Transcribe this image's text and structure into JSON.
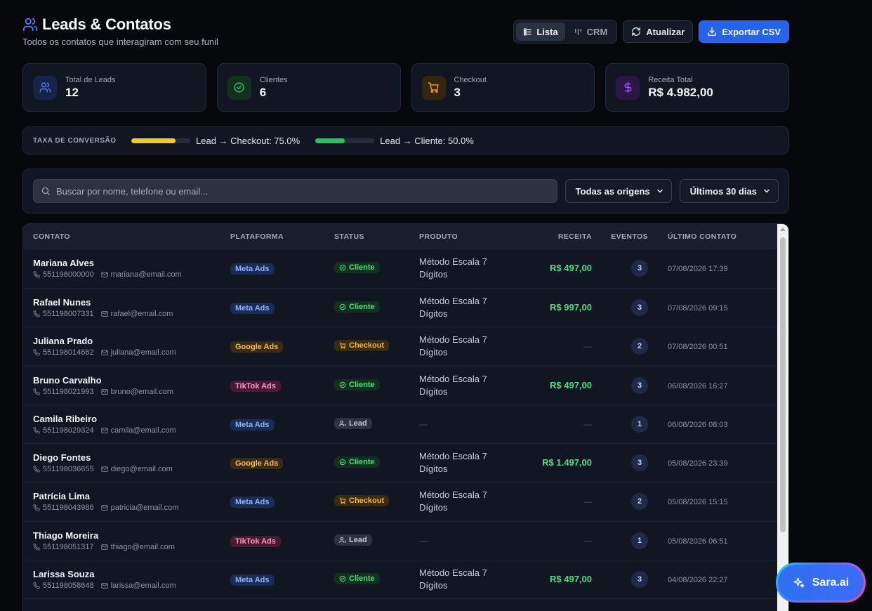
{
  "header": {
    "title": "Leads & Contatos",
    "subtitle": "Todos os contatos que interagiram com seu funil",
    "view_list": "Lista",
    "view_crm": "CRM",
    "refresh": "Atualizar",
    "export": "Exportar CSV"
  },
  "stats": [
    {
      "label": "Total de Leads",
      "value": "12",
      "icon": "users-icon",
      "color": "#4d7dff"
    },
    {
      "label": "Clientes",
      "value": "6",
      "icon": "check-circle-icon",
      "color": "#22c55e"
    },
    {
      "label": "Checkout",
      "value": "3",
      "icon": "cart-icon",
      "color": "#f59e0b"
    },
    {
      "label": "Receita Total",
      "value": "R$ 4.982,00",
      "icon": "dollar-icon",
      "color": "#a855f7"
    }
  ],
  "conversion": {
    "label": "TAXA DE CONVERSÃO",
    "items": [
      {
        "text": "Lead → Checkout: 75.0%",
        "percent": 75,
        "color": "#facc15"
      },
      {
        "text": "Lead → Cliente: 50.0%",
        "percent": 50,
        "color": "#22c55e"
      }
    ]
  },
  "filters": {
    "search_placeholder": "Buscar por nome, telefone ou email...",
    "origin": "Todas as origens",
    "period": "Últimos 30 dias"
  },
  "table": {
    "columns": {
      "contact": "CONTATO",
      "platform": "PLATAFORMA",
      "status": "STATUS",
      "product": "PRODUTO",
      "revenue": "RECEITA",
      "events": "EVENTOS",
      "last": "ÚLTIMO CONTATO"
    },
    "rows": [
      {
        "name": "Mariana Alves",
        "phone": "551198000000",
        "email": "mariana@email.com",
        "platform": "Meta Ads",
        "status": "Cliente",
        "product": "Método Escala 7 Dígitos",
        "revenue": "R$ 497,00",
        "events": "3",
        "last": "07/08/2026 17:39"
      },
      {
        "name": "Rafael Nunes",
        "phone": "551198007331",
        "email": "rafael@email.com",
        "platform": "Meta Ads",
        "status": "Cliente",
        "product": "Método Escala 7 Dígitos",
        "revenue": "R$ 997,00",
        "events": "3",
        "last": "07/08/2026 09:15"
      },
      {
        "name": "Juliana Prado",
        "phone": "551198014662",
        "email": "juliana@email.com",
        "platform": "Google Ads",
        "status": "Checkout",
        "product": "Método Escala 7 Dígitos",
        "revenue": "—",
        "events": "2",
        "last": "07/08/2026 00:51"
      },
      {
        "name": "Bruno Carvalho",
        "phone": "551198021993",
        "email": "bruno@email.com",
        "platform": "TikTok Ads",
        "status": "Cliente",
        "product": "Método Escala 7 Dígitos",
        "revenue": "R$ 497,00",
        "events": "3",
        "last": "06/08/2026 16:27"
      },
      {
        "name": "Camila Ribeiro",
        "phone": "551198029324",
        "email": "camila@email.com",
        "platform": "Meta Ads",
        "status": "Lead",
        "product": "—",
        "revenue": "—",
        "events": "1",
        "last": "06/08/2026 08:03"
      },
      {
        "name": "Diego Fontes",
        "phone": "551198036655",
        "email": "diego@email.com",
        "platform": "Google Ads",
        "status": "Cliente",
        "product": "Método Escala 7 Dígitos",
        "revenue": "R$ 1.497,00",
        "events": "3",
        "last": "05/08/2026 23:39"
      },
      {
        "name": "Patrícia Lima",
        "phone": "551198043986",
        "email": "patricia@email.com",
        "platform": "Meta Ads",
        "status": "Checkout",
        "product": "Método Escala 7 Dígitos",
        "revenue": "—",
        "events": "2",
        "last": "05/08/2026 15:15"
      },
      {
        "name": "Thiago Moreira",
        "phone": "551198051317",
        "email": "thiago@email.com",
        "platform": "TikTok Ads",
        "status": "Lead",
        "product": "—",
        "revenue": "—",
        "events": "1",
        "last": "05/08/2026 06:51"
      },
      {
        "name": "Larissa Souza",
        "phone": "551198058648",
        "email": "larissa@email.com",
        "platform": "Meta Ads",
        "status": "Cliente",
        "product": "Método Escala 7 Dígitos",
        "revenue": "R$ 497,00",
        "events": "3",
        "last": "04/08/2026 22:27"
      }
    ]
  },
  "assistant": {
    "label": "Sara.ai"
  }
}
